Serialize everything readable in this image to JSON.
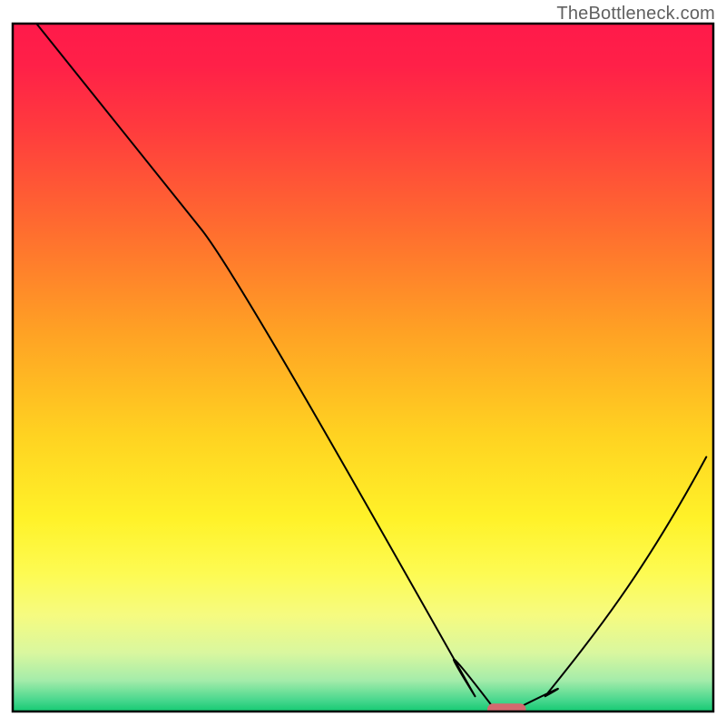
{
  "watermark": "TheBottleneck.com",
  "chart_data": {
    "type": "line",
    "title": "",
    "xlabel": "",
    "ylabel": "",
    "xlim": [
      0,
      100
    ],
    "ylim": [
      0,
      100
    ],
    "background_gradient": {
      "stops": [
        {
          "offset": 0.0,
          "color": "#ff1a4a"
        },
        {
          "offset": 0.06,
          "color": "#ff2048"
        },
        {
          "offset": 0.15,
          "color": "#ff3a3e"
        },
        {
          "offset": 0.3,
          "color": "#ff6d2f"
        },
        {
          "offset": 0.45,
          "color": "#ffa224"
        },
        {
          "offset": 0.6,
          "color": "#ffd321"
        },
        {
          "offset": 0.72,
          "color": "#fff229"
        },
        {
          "offset": 0.8,
          "color": "#fdfb53"
        },
        {
          "offset": 0.86,
          "color": "#f6fb80"
        },
        {
          "offset": 0.915,
          "color": "#d9f79f"
        },
        {
          "offset": 0.955,
          "color": "#a4ecaa"
        },
        {
          "offset": 0.985,
          "color": "#44d68c"
        },
        {
          "offset": 1.0,
          "color": "#14c971"
        }
      ]
    },
    "curve": {
      "name": "bottleneck-curve",
      "color": "#000000",
      "stroke_width": 2,
      "points": [
        {
          "x": 3.4,
          "y": 100.0
        },
        {
          "x": 27.0,
          "y": 70.0
        },
        {
          "x": 66.0,
          "y": 2.2
        },
        {
          "x": 68.5,
          "y": 0.7
        },
        {
          "x": 72.5,
          "y": 0.7
        },
        {
          "x": 76.0,
          "y": 2.2
        },
        {
          "x": 99.0,
          "y": 37.0
        }
      ],
      "smooth_segments": [
        {
          "from": 0,
          "to": 1,
          "type": "line"
        },
        {
          "from": 1,
          "to": 3,
          "type": "curve",
          "ctrl": [
            {
              "x": 32.0,
              "y": 63.5
            },
            {
              "x": 60.0,
              "y": 12.0
            }
          ]
        },
        {
          "from": 3,
          "to": 4,
          "type": "line"
        },
        {
          "from": 4,
          "to": 6,
          "type": "curve",
          "ctrl": [
            {
              "x": 80.0,
              "y": 4.5
            },
            {
              "x": 90.0,
              "y": 20.0
            }
          ]
        }
      ]
    },
    "marker": {
      "shape": "pill",
      "x": 70.5,
      "y": 0.3,
      "width": 5.5,
      "height": 1.7,
      "color": "#d36a6f"
    },
    "plot_frame": {
      "color": "#000000",
      "stroke_width": 2.5
    }
  }
}
